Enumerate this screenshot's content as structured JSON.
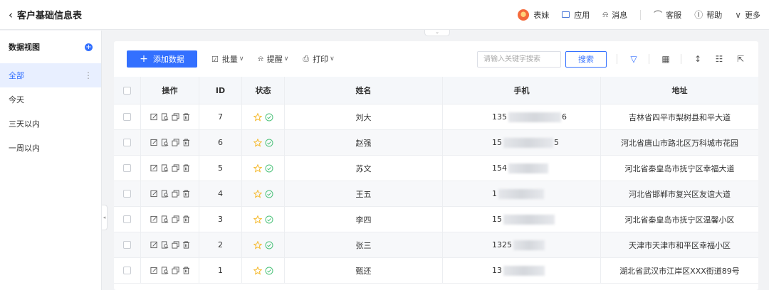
{
  "header": {
    "title": "客户基础信息表",
    "user": "表妹",
    "app": "应用",
    "messages": "消息",
    "service": "客服",
    "help": "帮助",
    "more": "更多"
  },
  "sidebar": {
    "heading": "数据视图",
    "items": [
      {
        "label": "全部"
      },
      {
        "label": "今天"
      },
      {
        "label": "三天以内"
      },
      {
        "label": "一周以内"
      }
    ]
  },
  "toolbar": {
    "add": "添加数据",
    "batch": "批量",
    "remind": "提醒",
    "print": "打印",
    "search_placeholder": "请输入关键字搜索",
    "search": "搜索"
  },
  "table": {
    "columns": {
      "actions": "操作",
      "id": "ID",
      "status": "状态",
      "name": "姓名",
      "phone": "手机",
      "address": "地址"
    },
    "rows": [
      {
        "id": "7",
        "name": "刘大",
        "phone_prefix": "135",
        "phone_suffix": "6",
        "address": "吉林省四平市梨树县和平大道"
      },
      {
        "id": "6",
        "name": "赵强",
        "phone_prefix": "15",
        "phone_suffix": "5",
        "address": "河北省唐山市路北区万科城市花园"
      },
      {
        "id": "5",
        "name": "苏文",
        "phone_prefix": "154",
        "phone_suffix": "",
        "address": "河北省秦皇岛市抚宁区幸福大道"
      },
      {
        "id": "4",
        "name": "王五",
        "phone_prefix": "1",
        "phone_suffix": "",
        "address": "河北省邯郸市复兴区友谊大道"
      },
      {
        "id": "3",
        "name": "李四",
        "phone_prefix": "15",
        "phone_suffix": "",
        "address": "河北省秦皇岛市抚宁区温馨小区"
      },
      {
        "id": "2",
        "name": "张三",
        "phone_prefix": "1325",
        "phone_suffix": "",
        "address": "天津市天津市和平区幸福小区"
      },
      {
        "id": "1",
        "name": "甄还",
        "phone_prefix": "13",
        "phone_suffix": "",
        "address": "湖北省武汉市江岸区XXX街道89号"
      }
    ]
  },
  "colors": {
    "accent": "#3370ff",
    "star": "#f5b828",
    "check": "#4cc27a"
  }
}
